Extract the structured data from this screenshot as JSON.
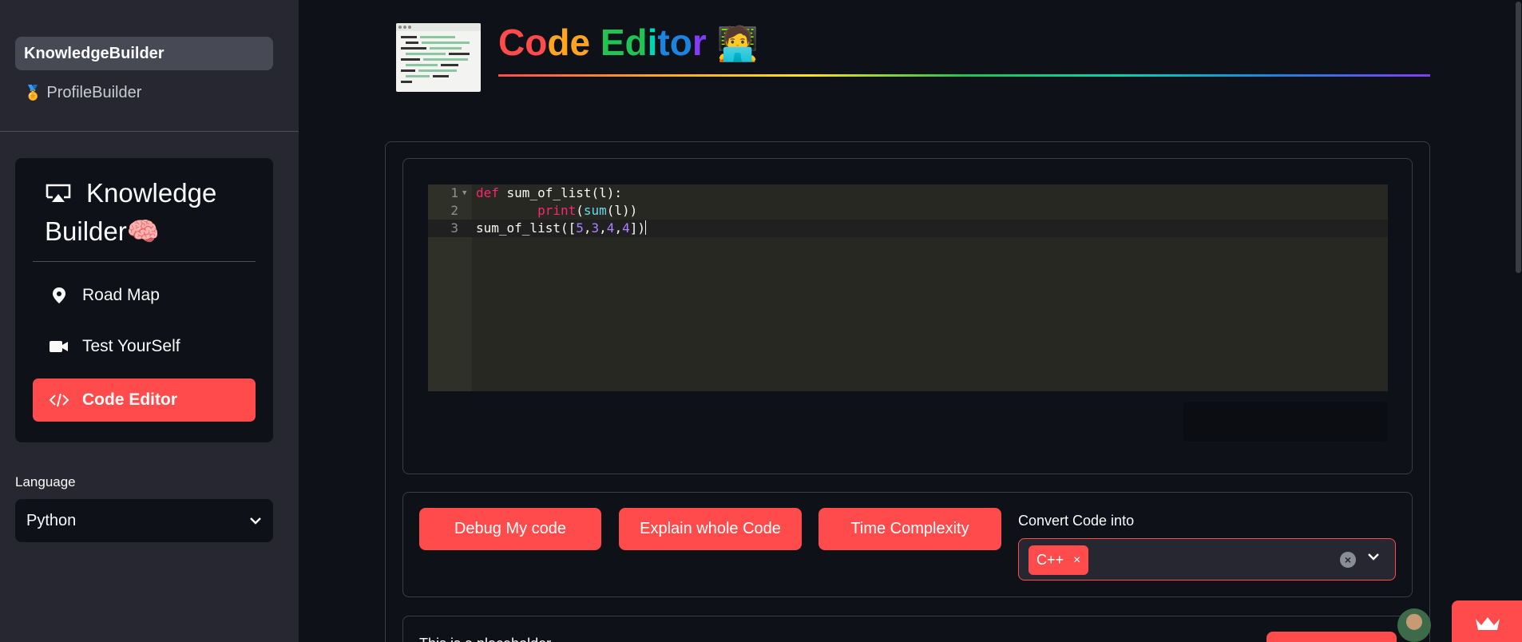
{
  "sidebar": {
    "pages": [
      {
        "label": "KnowledgeBuilder",
        "emoji": ""
      },
      {
        "label": "ProfileBuilder",
        "emoji": "🏅"
      }
    ],
    "menu": {
      "title": "Knowledge Builder🧠",
      "items": [
        {
          "label": "Road Map",
          "icon": "map-pin-icon"
        },
        {
          "label": "Test YourSelf",
          "icon": "camera-icon"
        },
        {
          "label": "Code Editor",
          "icon": "code-icon"
        }
      ],
      "selected": "Code Editor"
    },
    "language": {
      "label": "Language",
      "value": "Python"
    }
  },
  "main": {
    "title": "Code Editor",
    "title_emoji": "🧑‍💻",
    "title_colors": [
      "#ff4b4b",
      "#ffa421",
      "#ffe312",
      "#21c354",
      "#00d4b1",
      "#1c83e1",
      "#803df5"
    ],
    "editor": {
      "line_numbers": [
        "1",
        "2",
        "3"
      ],
      "lines": [
        "def sum_of_list(l):",
        "        print(sum(l))",
        "sum_of_list([5,3,4,4])"
      ]
    },
    "actions": {
      "debug": "Debug My code",
      "explain": "Explain whole Code",
      "complexity": "Time Complexity"
    },
    "convert": {
      "label": "Convert Code into",
      "selected": [
        "C++"
      ],
      "tag_remove": "×"
    },
    "bottom_text": "This is a placeholder"
  },
  "colors": {
    "accent": "#ff4b4b",
    "bg": "#0e1117",
    "sidebar": "#262730"
  }
}
